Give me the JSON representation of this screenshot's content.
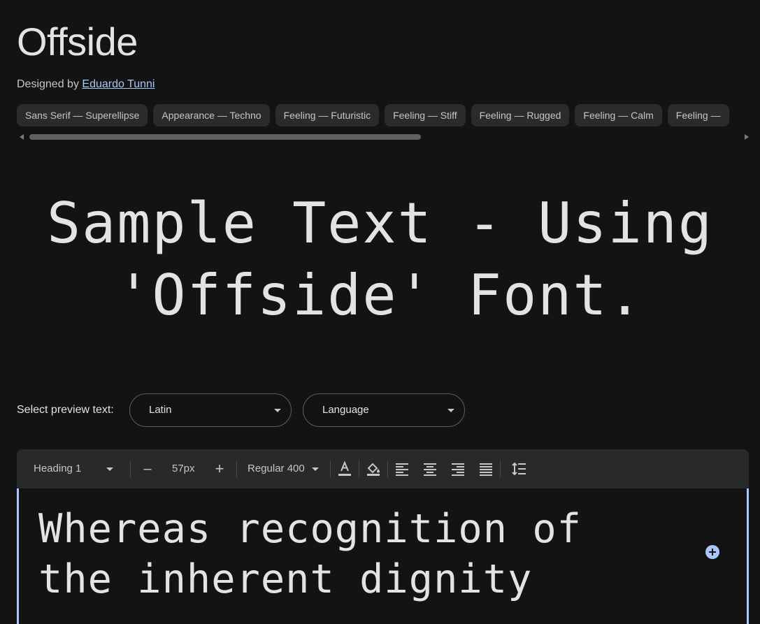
{
  "font": {
    "name": "Offside",
    "designed_by_prefix": "Designed by",
    "designer": "Eduardo Tunni"
  },
  "tags": [
    "Sans Serif — Superellipse",
    "Appearance — Techno",
    "Feeling — Futuristic",
    "Feeling — Stiff",
    "Feeling — Rugged",
    "Feeling — Calm",
    "Feeling —"
  ],
  "sample": {
    "line1": "Sample Text - Using",
    "line2": "'Offside' Font."
  },
  "preview": {
    "label": "Select preview text:",
    "script_select": "Latin",
    "language_select": "Language"
  },
  "toolbar": {
    "style": "Heading 1",
    "decrease": "–",
    "size": "57px",
    "increase": "+",
    "weight": "Regular 400"
  },
  "editor": {
    "text": "Whereas recognition of the inherent dignity"
  },
  "colors": {
    "background": "#131314",
    "chip": "#2a2b2d",
    "toolbar": "#28292b",
    "accent": "#a8c7fa"
  },
  "icons": [
    "text-color-icon",
    "highlight-color-icon",
    "align-left-icon",
    "align-center-icon",
    "align-right-icon",
    "align-justify-icon",
    "line-height-icon",
    "add-icon"
  ]
}
